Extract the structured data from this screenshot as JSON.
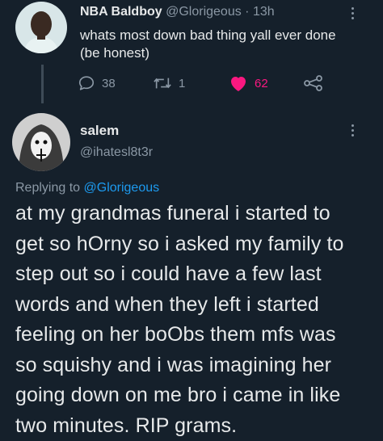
{
  "parent_tweet": {
    "display_name": "NBA Baldboy",
    "handle": "@Glorigeous",
    "separator": "·",
    "time": "13h",
    "text": "whats most down bad thing yall ever done\n(be honest)",
    "actions": {
      "reply_count": "38",
      "retweet_count": "1",
      "like_count": "62"
    }
  },
  "reply_tweet": {
    "display_name": "salem",
    "handle": "@ihatesl8t3r",
    "replying_prefix": "Replying to",
    "replying_to": "@Glorigeous",
    "text": "at my grandmas funeral i started to\nget so hOrny so i asked my family to\nstep out so i could have a few last\nwords and when they left i started\nfeeling on her boObs them mfs was\nso squishy and i was imagining her\ngoing down on me bro i came in like\ntwo minutes. RIP grams."
  },
  "colors": {
    "background": "#15202b",
    "text_primary": "#e7e9ea",
    "text_secondary": "#8b98a5",
    "link": "#1d9bf0",
    "like": "#f91880"
  },
  "icons": {
    "reply": "reply-bubble-icon",
    "retweet": "retweet-icon",
    "like": "heart-filled-icon",
    "share": "share-icon",
    "more": "more-vertical-icon"
  }
}
